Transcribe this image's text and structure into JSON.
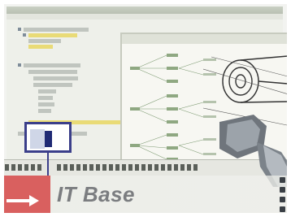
{
  "brand": {
    "name": "IT Base"
  },
  "icons": {
    "arrow": "arrow-right-icon",
    "magnifier": "selection-box",
    "machine": "gear-part-illustration"
  },
  "colors": {
    "accent_red": "#d9605f",
    "selection_blue": "#3b3f8a",
    "brand_gray": "#7b7d80"
  }
}
